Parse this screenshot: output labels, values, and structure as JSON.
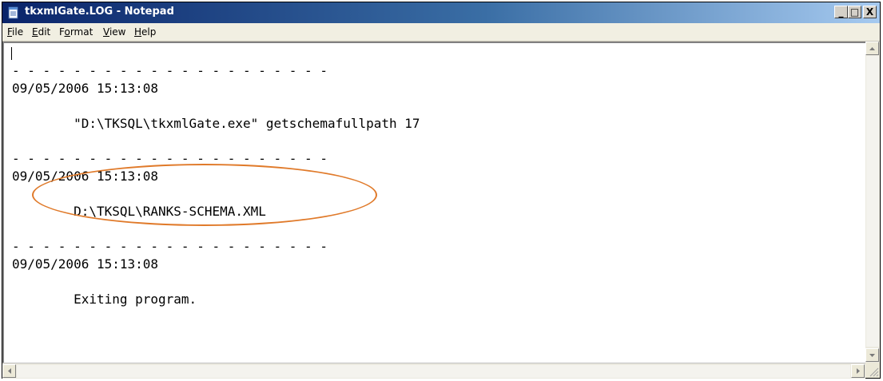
{
  "window": {
    "title": "tkxmlGate.LOG - Notepad",
    "icons": {
      "app": "notepad-icon",
      "minimize": "minimize-icon",
      "maximize": "maximize-icon",
      "close": "close-icon"
    },
    "controls": {
      "minimize_label": "_",
      "maximize_label": "□",
      "close_label": "X"
    }
  },
  "menu": {
    "items": [
      {
        "label": "File",
        "underline": "F"
      },
      {
        "label": "Edit",
        "underline": "E"
      },
      {
        "label": "Format",
        "underline": "o"
      },
      {
        "label": "View",
        "underline": "V"
      },
      {
        "label": "Help",
        "underline": "H"
      }
    ]
  },
  "document": {
    "lines": [
      "",
      "- - - - - - - - - - - - - - - - - - - - -",
      "09/05/2006 15:13:08",
      "",
      "        \"D:\\TKSQL\\tkxmlGate.exe\" getschemafullpath 17",
      "",
      "- - - - - - - - - - - - - - - - - - - - -",
      "09/05/2006 15:13:08",
      "",
      "        D:\\TKSQL\\RANKS-SCHEMA.XML",
      "",
      "- - - - - - - - - - - - - - - - - - - - -",
      "09/05/2006 15:13:08",
      "",
      "        Exiting program."
    ]
  },
  "annotation": {
    "highlight_color": "#e07a2a"
  },
  "colors": {
    "titlebar_start": "#0a246a",
    "titlebar_end": "#a6caf0"
  }
}
